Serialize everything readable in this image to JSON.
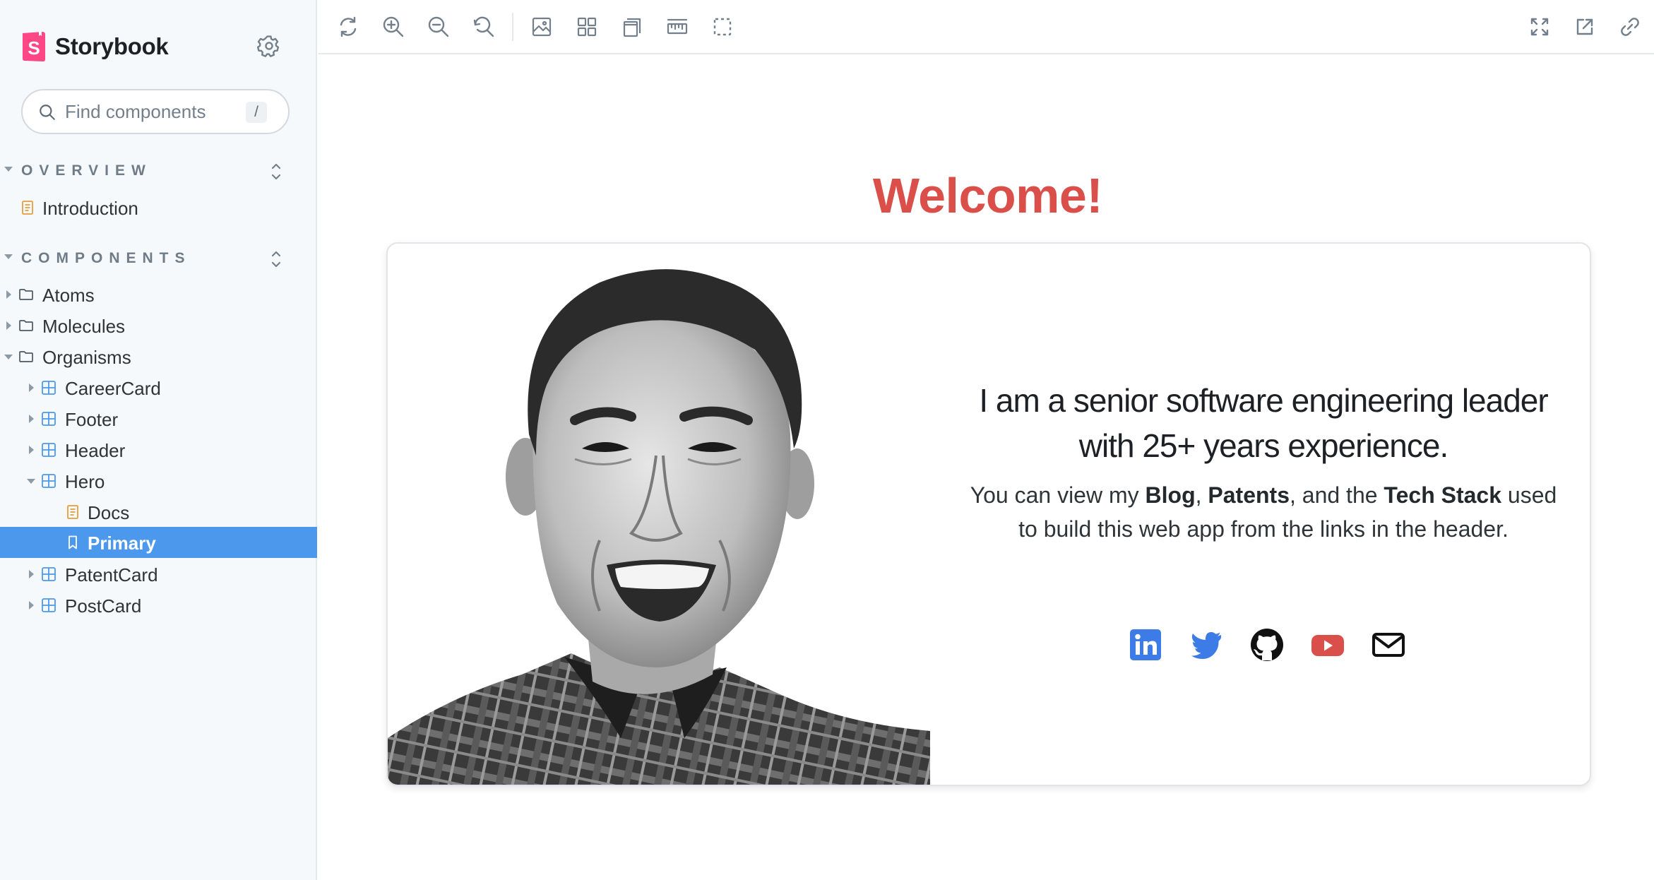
{
  "brand": {
    "name": "Storybook",
    "accent": "#ff4785"
  },
  "search": {
    "placeholder": "Find components",
    "shortcut": "/"
  },
  "sections": [
    {
      "title": "OVERVIEW"
    },
    {
      "title": "COMPONENTS"
    }
  ],
  "tree": {
    "introduction": "Introduction",
    "atoms": "Atoms",
    "molecules": "Molecules",
    "organisms": "Organisms",
    "career_card": "CareerCard",
    "footer": "Footer",
    "header": "Header",
    "hero": "Hero",
    "docs": "Docs",
    "primary": "Primary",
    "patent_card": "PatentCard",
    "post_card": "PostCard"
  },
  "toolbar": {
    "left_icons": [
      "remount-icon",
      "zoom-in-icon",
      "zoom-out-icon",
      "zoom-reset-icon",
      "background-icon",
      "grid-icon",
      "viewport-icon",
      "measure-icon",
      "outline-icon"
    ],
    "right_icons": [
      "fullscreen-icon",
      "open-new-tab-icon",
      "copy-link-icon"
    ]
  },
  "hero": {
    "title": "Welcome!",
    "headline_1": "I am a senior software engineering leader",
    "headline_2": "with 25+ years experience.",
    "body_pre": "You can view my ",
    "blog": "Blog",
    "comma": ", ",
    "patents": "Patents",
    "and_the": ", and the ",
    "tech_stack": "Tech Stack",
    "body_post_1": " used",
    "body_post_2": "to build this web app from the links in the header.",
    "socials": [
      "linkedin-icon",
      "twitter-icon",
      "github-icon",
      "youtube-icon",
      "email-icon"
    ]
  },
  "colors": {
    "title_red": "#db4f4b",
    "selected_blue": "#4b98ec",
    "linkedin": "#3d7be6",
    "twitter": "#3d7be6",
    "youtube": "#db4f4b"
  }
}
